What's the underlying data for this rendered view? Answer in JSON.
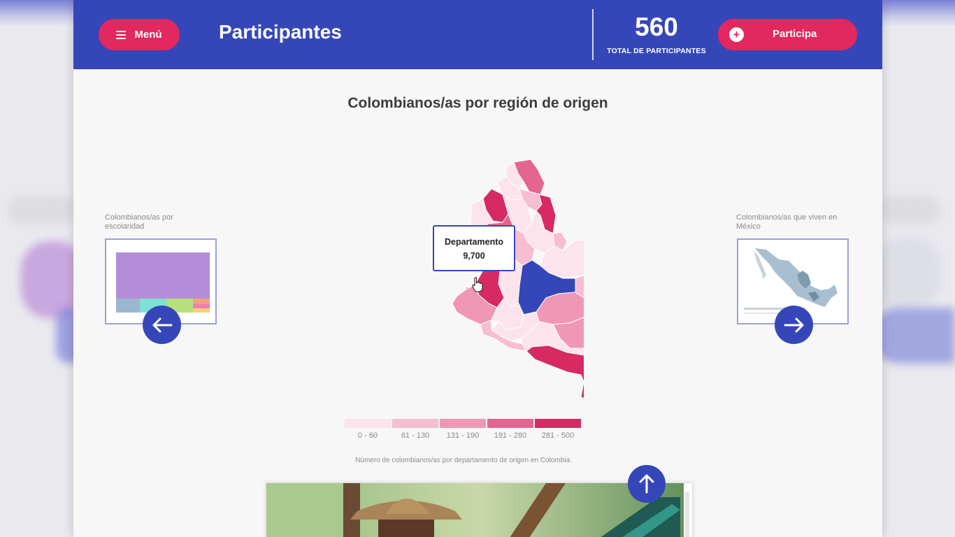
{
  "header": {
    "menu_label": "Menú",
    "title": "Participantes",
    "total_count": "560",
    "total_label": "TOTAL DE PARTICIPANTES",
    "participa_label": "Participa"
  },
  "section": {
    "title": "Colombianos/as por región de origen"
  },
  "prev_card": {
    "caption": "Colombianos/as por escolaridad",
    "icon": "arrow-left-icon"
  },
  "next_card": {
    "caption": "Colombianos/as que viven en México",
    "icon": "arrow-right-icon"
  },
  "tooltip": {
    "label": "Departamento",
    "value": "9,700"
  },
  "legend": {
    "items": [
      {
        "label": "0 - 60",
        "color": "#fde3ec"
      },
      {
        "label": "61 - 130",
        "color": "#f7bdd0"
      },
      {
        "label": "131 - 190",
        "color": "#ef97b4"
      },
      {
        "label": "191 - 280",
        "color": "#e46590"
      },
      {
        "label": "281 - 500",
        "color": "#d72a62"
      }
    ],
    "caption": "Número de colombianos/as por departamento de origen en Colombia."
  },
  "colors": {
    "brand_blue": "#3547b8",
    "brand_pink": "#e2285e",
    "highlight": "#3547b8"
  }
}
